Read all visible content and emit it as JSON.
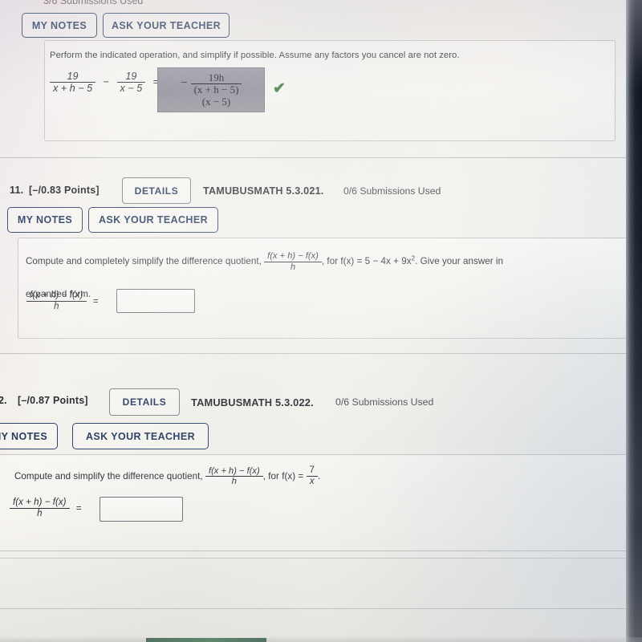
{
  "page": {
    "platform_note": "WebAssign-style online homework, photographed screen",
    "background_color": "#eceae4",
    "bezel_color": "#141a26",
    "accent_blue": "#1d3357",
    "check_green": "#3a7a3f",
    "answer_box_grey": "#908c9a"
  },
  "top_partial_question": {
    "submissions_used": "3/6 Submissions Used",
    "my_notes_label": "MY NOTES",
    "ask_teacher_label": "ASK YOUR TEACHER",
    "prompt": "Perform the indicated operation, and simplify if possible. Assume any factors you cancel are not zero.",
    "expression": {
      "term1_num": "19",
      "term1_den": "x + h − 5",
      "operator": "−",
      "term2_num": "19",
      "term2_den": "x − 5",
      "equals": "="
    },
    "answer": {
      "sign": "−",
      "numerator": "19h",
      "denominator_line1": "(x + h − 5)",
      "denominator_line2": "(x − 5)",
      "status_icon": "check-icon",
      "status": "correct"
    }
  },
  "questions": [
    {
      "number": "11.",
      "points": "[–/0.83 Points]",
      "details_label": "DETAILS",
      "reference": "TAMUBUSMATH 5.3.021.",
      "submissions_used": "0/6 Submissions Used",
      "my_notes_label": "MY NOTES",
      "ask_teacher_label": "ASK YOUR TEACHER",
      "prompt_part1": "Compute and completely simplify the difference quotient,",
      "quotient_num": "f(x + h) − f(x)",
      "quotient_den": "h",
      "prompt_part2": ", for f(x) = 5 − 4x + 9x",
      "prompt_exponent": "2",
      "prompt_part3": ". Give your answer in",
      "prompt_part4": "expanded form.",
      "answer_label_num": "f(x + h) − f(x)",
      "answer_label_den": "h",
      "answer_equals": "=",
      "answer_value": "",
      "answer_placeholder": ""
    },
    {
      "number": "2.",
      "points": "[–/0.87 Points]",
      "details_label": "DETAILS",
      "reference": "TAMUBUSMATH 5.3.022.",
      "submissions_used": "0/6 Submissions Used",
      "my_notes_label": "MY NOTES",
      "ask_teacher_label": "ASK YOUR TEACHER",
      "prompt_part1": "Compute and simplify the difference quotient,",
      "quotient_num": "f(x + h) − f(x)",
      "quotient_den": "h",
      "prompt_part2": ", for f(x) =",
      "fx_num": "7",
      "fx_den": "x",
      "prompt_part3": ".",
      "answer_label_num": "f(x + h) − f(x)",
      "answer_label_den": "h",
      "answer_equals": "=",
      "answer_value": "",
      "answer_placeholder": ""
    }
  ]
}
